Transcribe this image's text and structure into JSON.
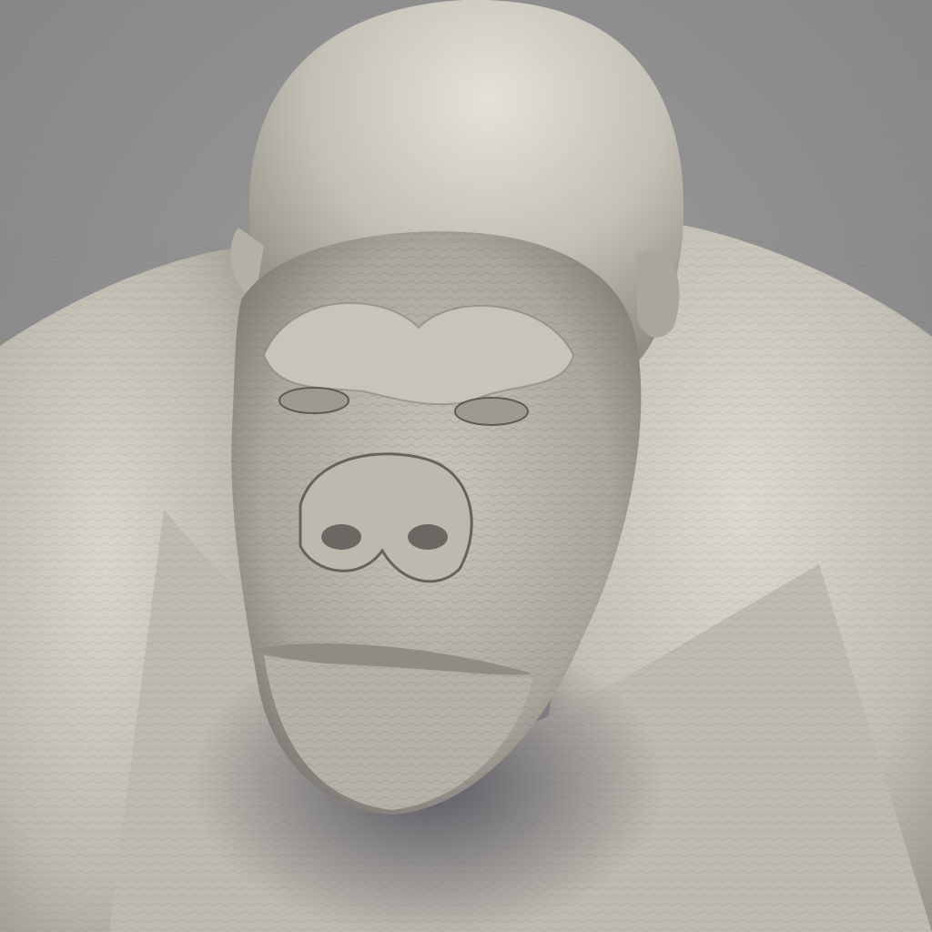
{
  "scene": {
    "subject_icon": "gorilla-bust-sculpt-icon",
    "material": "clay",
    "colors": {
      "background": "#8e8e8e",
      "clay_light": "#d8d6cc",
      "clay_mid": "#b7b4a9",
      "clay_dark": "#6f6c66",
      "shadow": "#4a4855"
    }
  }
}
